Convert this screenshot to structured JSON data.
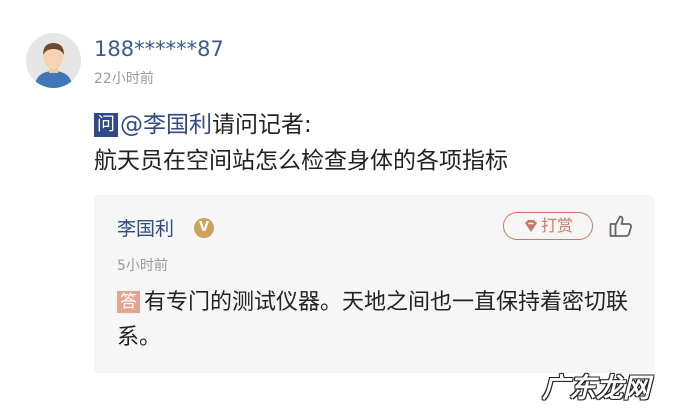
{
  "comment": {
    "username": "188******87",
    "timestamp": "22小时前",
    "question_badge": "问",
    "mention": "@李国利",
    "question_text_1": "请问记者:",
    "question_text_2": "航天员在空间站怎么检查身体的各项指标"
  },
  "reply": {
    "replier_name": "李国利",
    "verified_badge": "V",
    "tip_label": "打赏",
    "timestamp": "5小时前",
    "answer_badge": "答",
    "answer_text": "有专门的测试仪器。天地之间也一直保持着密切联系。"
  },
  "watermark": "广东龙网",
  "colors": {
    "link_blue": "#2f4a86",
    "tip_accent": "#c97a64",
    "answer_badge": "#e4a58f",
    "verified_gold": "#c9a35e",
    "reply_background": "#f6f6f6"
  },
  "icons": [
    "avatar",
    "verified-icon",
    "gem-icon",
    "thumbs-up-icon"
  ]
}
